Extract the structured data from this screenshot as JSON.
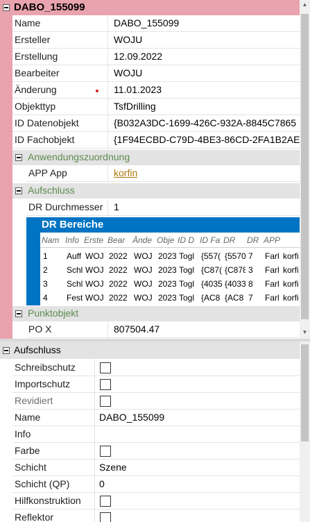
{
  "panel1": {
    "title": "DABO_155099",
    "properties": [
      {
        "label": "Name",
        "value": "DABO_155099"
      },
      {
        "label": "Ersteller",
        "value": "WOJU"
      },
      {
        "label": "Erstellung",
        "value": "12.09.2022"
      },
      {
        "label": "Bearbeiter",
        "value": "WOJU"
      },
      {
        "label": "Änderung",
        "value": "11.01.2023"
      },
      {
        "label": "Objekttyp",
        "value": "TsfDrilling"
      },
      {
        "label": "ID Datenobjekt",
        "value": "{B032A3DC-1699-426C-932A-8845C7865"
      },
      {
        "label": "ID Fachobjekt",
        "value": "{1F94ECBD-C79D-4BE3-86CD-2FA1B2AE"
      }
    ],
    "sections": {
      "anwendung": {
        "title": "Anwendungszuordnung",
        "label": "APP App",
        "value": "korfin"
      },
      "aufschluss": {
        "title": "Aufschluss",
        "label": "DR Durchmesser",
        "value": "1"
      },
      "punkt": {
        "title": "Punktobjekt",
        "label": "PO X",
        "value": "807504.47"
      }
    },
    "dr_table": {
      "title": "DR Bereiche",
      "columns": [
        "Nam",
        "Info",
        "Erste",
        "Bear",
        "Ände",
        "Obje",
        "ID D",
        "ID Fa",
        "DR",
        "DR",
        "APP"
      ],
      "rows": [
        [
          "1",
          "Auff",
          "WOJ",
          "2022",
          "WOJ",
          "2023",
          "Togl",
          "{557(",
          "{5570",
          "7",
          "Farl",
          "korfi"
        ],
        [
          "2",
          "Schl",
          "WOJ",
          "2022",
          "WOJ",
          "2023",
          "Togl",
          "{C87(",
          "{C878",
          "3",
          "Farl",
          "korfi"
        ],
        [
          "3",
          "Schl",
          "WOJ",
          "2022",
          "WOJ",
          "2023",
          "Togl",
          "{4035",
          "{4033",
          "8",
          "Farl",
          "korfi"
        ],
        [
          "4",
          "Fest",
          "WOJ",
          "2022",
          "WOJ",
          "2023",
          "Togl",
          "{AC8",
          "{AC8",
          "7",
          "Farl",
          "korfi"
        ]
      ]
    }
  },
  "panel2": {
    "title": "Aufschluss",
    "rows": [
      {
        "label": "Schreibschutz",
        "value": "",
        "checkbox": true
      },
      {
        "label": "Importschutz",
        "value": "",
        "checkbox": true
      },
      {
        "label": "Revidiert",
        "value": "",
        "checkbox": true
      },
      {
        "label": "Name",
        "value": "DABO_155099",
        "checkbox": false
      },
      {
        "label": "Info",
        "value": "",
        "checkbox": false
      },
      {
        "label": "Farbe",
        "value": "",
        "checkbox": true
      },
      {
        "label": "Schicht",
        "value": "Szene",
        "checkbox": false
      },
      {
        "label": "Schicht (QP)",
        "value": "0",
        "checkbox": false
      },
      {
        "label": "Hilfkonstruktion",
        "value": "",
        "checkbox": true
      },
      {
        "label": "Reflektor",
        "value": "",
        "checkbox": true
      }
    ]
  },
  "colors": {
    "header_pink": "#e9a3ae",
    "section_green": "#5d8b4f",
    "table_blue": "#0074c4",
    "link": "#b07a10",
    "change_dot": "#d62020"
  }
}
